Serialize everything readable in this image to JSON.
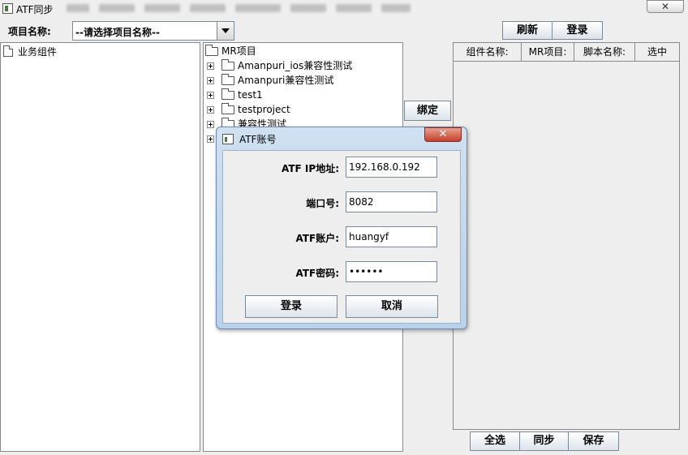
{
  "window": {
    "title": "ATF同步",
    "close_glyph": "✕"
  },
  "toolbar": {
    "project_label": "项目名称:",
    "project_select_value": "--请选择项目名称--",
    "refresh_label": "刷新",
    "login_label": "登录"
  },
  "left_panel": {
    "item_label": "业务组件"
  },
  "tree": {
    "root_label": "MR项目",
    "items": [
      {
        "label": "Amanpuri_ios兼容性测试"
      },
      {
        "label": "Amanpuri兼容性测试"
      },
      {
        "label": "test1"
      },
      {
        "label": "testproject"
      },
      {
        "label": "兼容性测试"
      }
    ]
  },
  "bind_label": "绑定",
  "table": {
    "columns": [
      {
        "label": "组件名称:"
      },
      {
        "label": "MR项目:"
      },
      {
        "label": "脚本名称:"
      },
      {
        "label": "选中"
      }
    ]
  },
  "bottom": {
    "select_all_label": "全选",
    "sync_label": "同步",
    "save_label": "保存"
  },
  "dialog": {
    "title": "ATF账号",
    "close_glyph": "✕",
    "fields": [
      {
        "label": "ATF IP地址:",
        "value": "192.168.0.192"
      },
      {
        "label": "端口号:",
        "value": "8082"
      },
      {
        "label": "ATF账户:",
        "value": "huangyf"
      },
      {
        "label": "ATF密码:",
        "value": "••••••"
      }
    ],
    "login_label": "登录",
    "cancel_label": "取消"
  }
}
